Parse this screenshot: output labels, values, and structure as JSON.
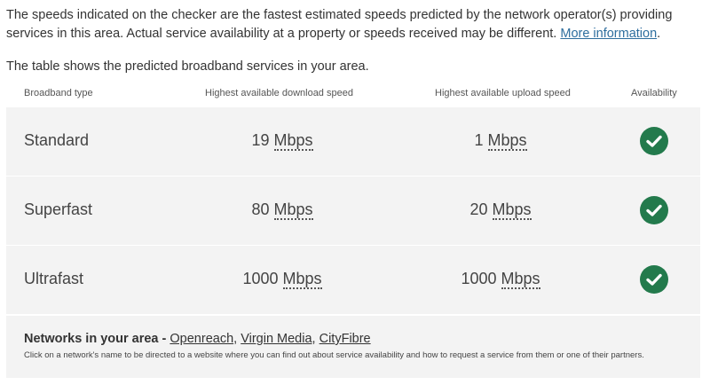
{
  "intro": {
    "text": "The speeds indicated on the checker are the fastest estimated speeds predicted by the network operator(s) providing services in this area. Actual service availability at a property or speeds received may be different.",
    "link_label": "More information",
    "after_link": "."
  },
  "table_intro": "The table shows the predicted broadband services in your area.",
  "table": {
    "headers": {
      "type": "Broadband type",
      "download": "Highest available download speed",
      "upload": "Highest available upload speed",
      "availability": "Availability"
    },
    "rows": [
      {
        "type": "Standard",
        "download_value": "19",
        "upload_value": "1",
        "unit": "Mbps",
        "available_icon": "check-circle-icon"
      },
      {
        "type": "Superfast",
        "download_value": "80",
        "upload_value": "20",
        "unit": "Mbps",
        "available_icon": "check-circle-icon"
      },
      {
        "type": "Ultrafast",
        "download_value": "1000",
        "upload_value": "1000",
        "unit": "Mbps",
        "available_icon": "check-circle-icon"
      }
    ]
  },
  "networks": {
    "label": "Networks in your area - ",
    "providers": [
      "Openreach",
      "Virgin Media",
      "CityFibre"
    ],
    "separator": ", ",
    "note": "Click on a network's name to be directed to a website where you can find out about service availability and how to request a service from them or one of their partners."
  },
  "colors": {
    "check_green": "#237a4c",
    "row_background": "#f3f3f3",
    "link_blue": "#2e6e9e"
  }
}
